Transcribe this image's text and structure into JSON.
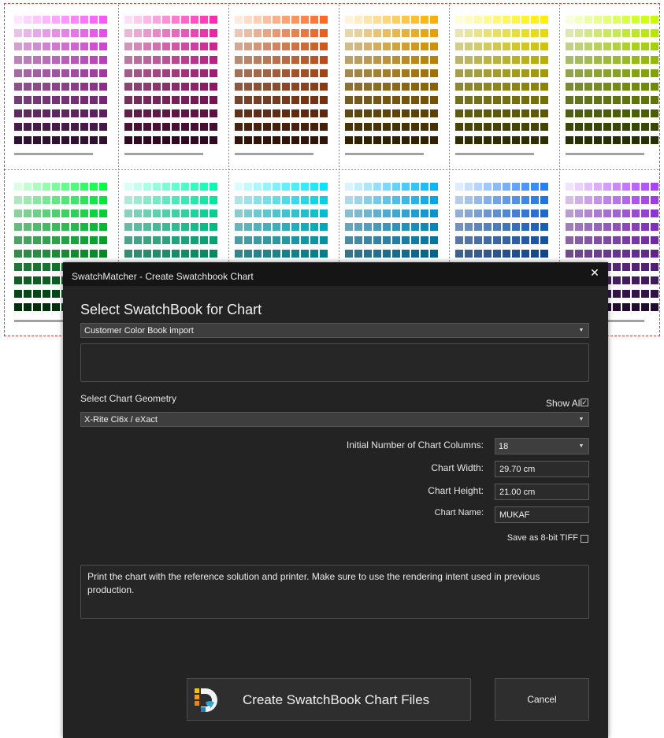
{
  "window": {
    "title": "SwatchMatcher - Create Swatchbook Chart",
    "close_glyph": "✕"
  },
  "swatchbook": {
    "heading": "Select SwatchBook for Chart",
    "selected": "Customer Color Book import",
    "description": ""
  },
  "geometry": {
    "heading": "Select Chart Geometry",
    "show_all_label": "Show All",
    "show_all_checked": true,
    "selected": "X-Rite Ci6x / eXact"
  },
  "settings": {
    "columns_label": "Initial Number of Chart Columns:",
    "columns_value": "18",
    "width_label": "Chart Width:",
    "width_value": "29.70 cm",
    "height_label": "Chart Height:",
    "height_value": "21.00 cm",
    "name_label": "Chart Name:",
    "name_value": "MUKAF",
    "tiff_label": "Save as 8-bit TIFF",
    "tiff_checked": false
  },
  "instructions": "Print the chart with the reference solution and printer. Make sure to use the rendering intent used in previous production.",
  "buttons": {
    "create": "Create SwatchBook Chart Files",
    "cancel": "Cancel"
  },
  "background_chart": {
    "hues_top": [
      "#ff55ff",
      "#ff2bb4",
      "#ff6a20",
      "#ffb000",
      "#fff000",
      "#c8ff00"
    ],
    "hues_bottom": [
      "#00ff40",
      "#00ffb0",
      "#00e8ff",
      "#00b8ff",
      "#2080ff",
      "#b040ff"
    ]
  }
}
